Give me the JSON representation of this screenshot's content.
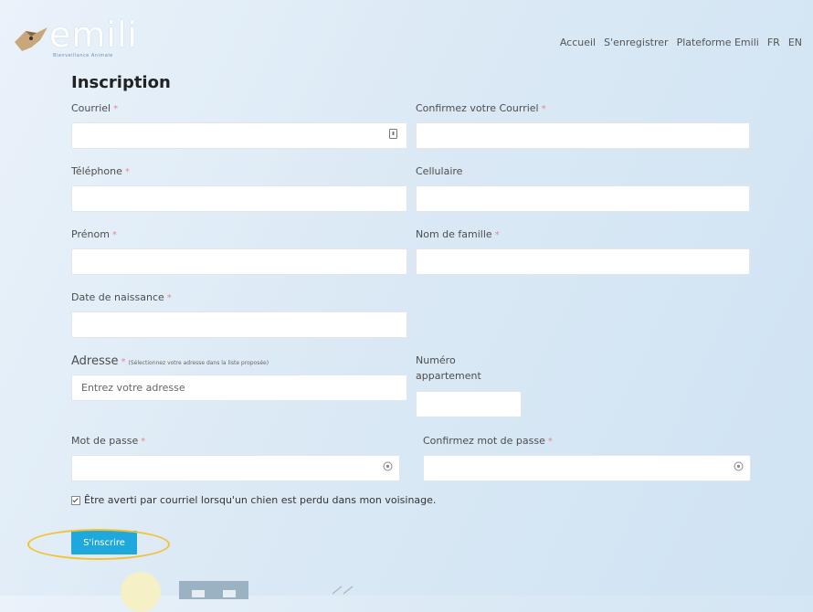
{
  "brand": {
    "name": "emili",
    "tagline": "Bienveillance Animale"
  },
  "nav": {
    "items": [
      "Accueil",
      "S'enregistrer",
      "Plateforme Emili",
      "FR",
      "EN"
    ]
  },
  "form": {
    "title": "Inscription",
    "required_mark": "*",
    "fields": {
      "email": {
        "label": "Courriel",
        "value": ""
      },
      "email_confirm": {
        "label": "Confirmez votre Courriel",
        "value": ""
      },
      "phone": {
        "label": "Téléphone",
        "value": ""
      },
      "mobile": {
        "label": "Cellulaire",
        "value": ""
      },
      "first_name": {
        "label": "Prénom",
        "value": ""
      },
      "last_name": {
        "label": "Nom de famille",
        "value": ""
      },
      "birth_date": {
        "label": "Date de naissance",
        "value": ""
      },
      "address": {
        "label": "Adresse",
        "hint": "(Sélectionnez votre adresse dans la liste proposée)",
        "placeholder": "Entrez votre adresse",
        "value": ""
      },
      "apartment": {
        "label_line1": "Numéro",
        "label_line2": "appartement",
        "value": ""
      },
      "password": {
        "label": "Mot de passe",
        "value": ""
      },
      "password_confirm": {
        "label": "Confirmez mot de passe",
        "value": ""
      }
    },
    "notify_checkbox": {
      "label": "Être averti par courriel lorsqu'un chien est perdu dans mon voisinage.",
      "checked": true
    },
    "submit_label": "S'inscrire"
  },
  "colors": {
    "accent": "#1fa8dc",
    "required": "#e48b8b",
    "highlight": "#f2c230"
  },
  "icons": {
    "email_field": "contact-card-icon",
    "password_field": "eye-icon"
  }
}
